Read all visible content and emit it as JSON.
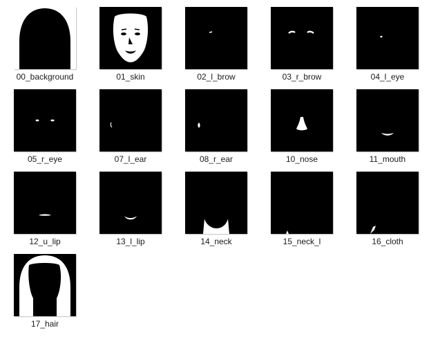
{
  "files": [
    {
      "name": "00_background",
      "icon": "background-mask-thumbnail"
    },
    {
      "name": "01_skin",
      "icon": "skin-mask-thumbnail"
    },
    {
      "name": "02_l_brow",
      "icon": "left-brow-mask-thumbnail"
    },
    {
      "name": "03_r_brow",
      "icon": "right-brow-mask-thumbnail"
    },
    {
      "name": "04_l_eye",
      "icon": "left-eye-mask-thumbnail"
    },
    {
      "name": "05_r_eye",
      "icon": "right-eye-mask-thumbnail"
    },
    {
      "name": "07_l_ear",
      "icon": "left-ear-mask-thumbnail"
    },
    {
      "name": "08_r_ear",
      "icon": "right-ear-mask-thumbnail"
    },
    {
      "name": "10_nose",
      "icon": "nose-mask-thumbnail"
    },
    {
      "name": "11_mouth",
      "icon": "mouth-mask-thumbnail"
    },
    {
      "name": "12_u_lip",
      "icon": "upper-lip-mask-thumbnail"
    },
    {
      "name": "13_l_lip",
      "icon": "lower-lip-mask-thumbnail"
    },
    {
      "name": "14_neck",
      "icon": "neck-mask-thumbnail"
    },
    {
      "name": "15_neck_l",
      "icon": "neck-l-mask-thumbnail"
    },
    {
      "name": "16_cloth",
      "icon": "cloth-mask-thumbnail"
    },
    {
      "name": "17_hair",
      "icon": "hair-mask-thumbnail"
    }
  ],
  "colors": {
    "mask_fg": "#ffffff",
    "mask_bg": "#000000",
    "label_text": "#1a1a1a",
    "page_bg": "#ffffff"
  }
}
